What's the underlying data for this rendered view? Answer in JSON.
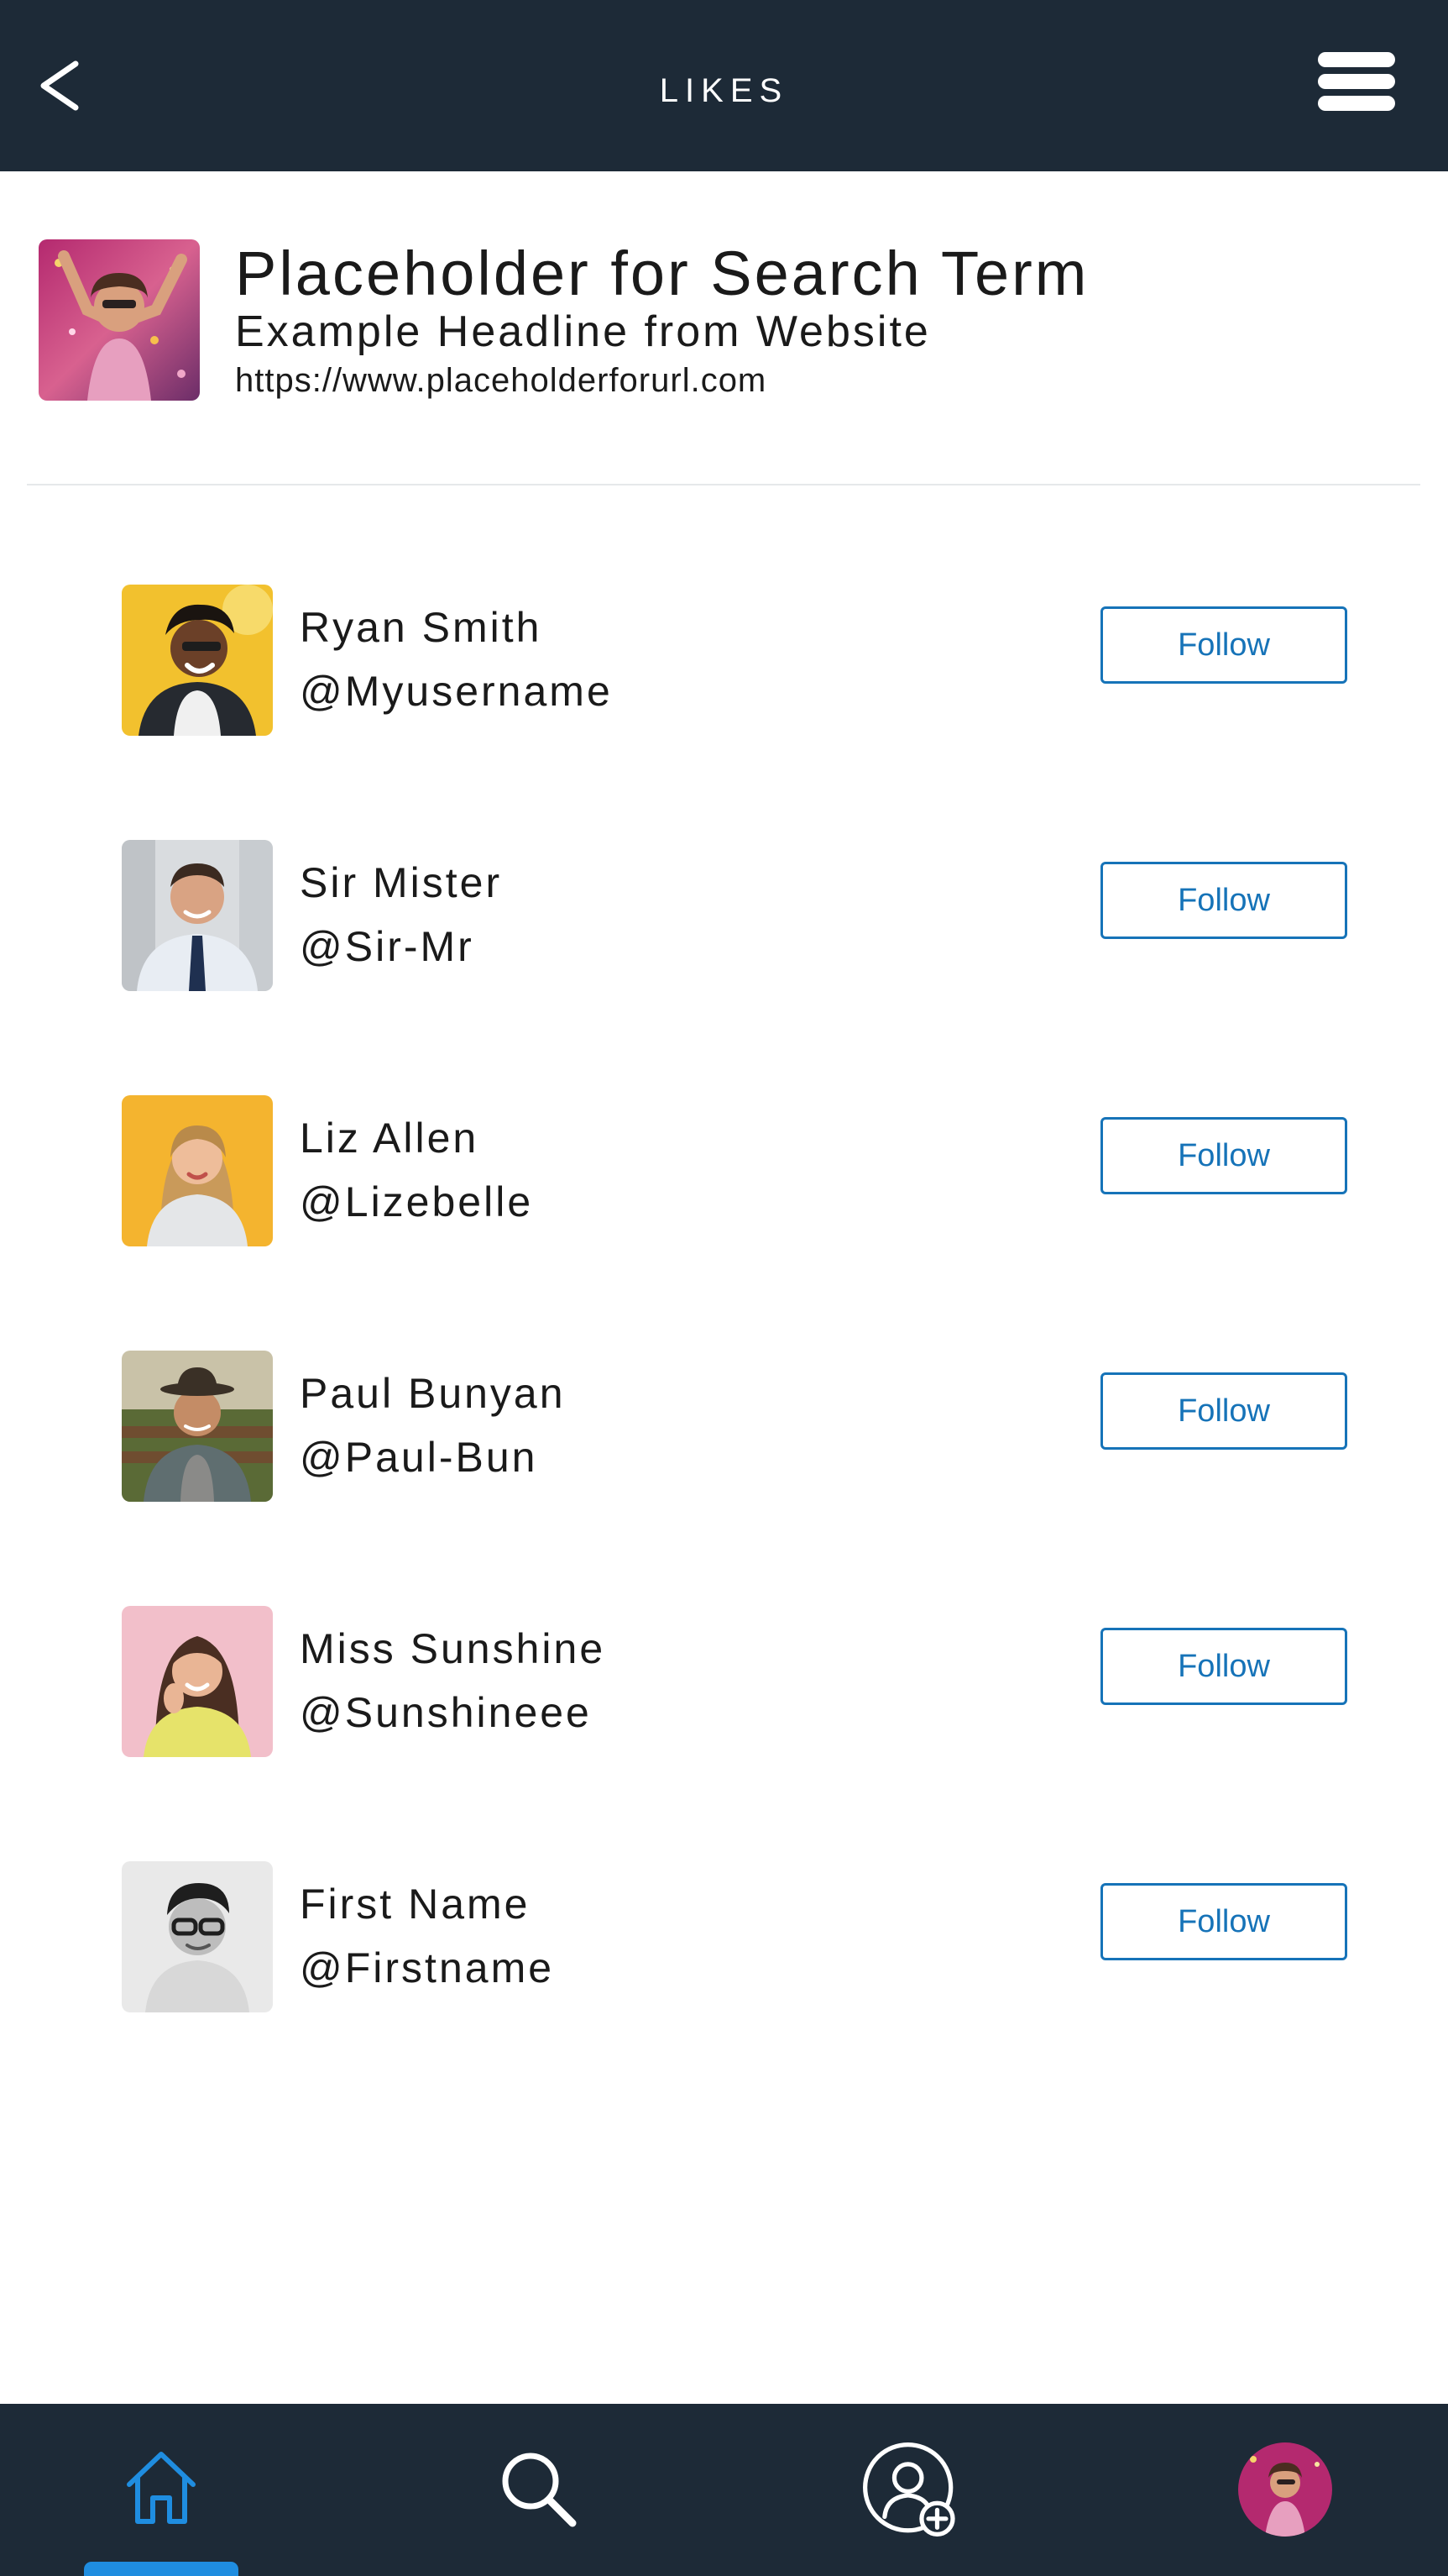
{
  "header": {
    "title": "LIKES",
    "back_icon": "chevron-left-icon",
    "menu_icon": "hamburger-menu-icon"
  },
  "shared_item": {
    "title": "Placeholder for Search Term",
    "headline": "Example Headline from Website",
    "url": "https://www.placeholderforurl.com"
  },
  "likes": [
    {
      "name": "Ryan Smith",
      "handle": "@Myusername",
      "follow_label": "Follow"
    },
    {
      "name": "Sir Mister",
      "handle": "@Sir-Mr",
      "follow_label": "Follow"
    },
    {
      "name": "Liz Allen",
      "handle": "@Lizebelle",
      "follow_label": "Follow"
    },
    {
      "name": "Paul Bunyan",
      "handle": "@Paul-Bun",
      "follow_label": "Follow"
    },
    {
      "name": "Miss Sunshine",
      "handle": "@Sunshineee",
      "follow_label": "Follow"
    },
    {
      "name": "First Name",
      "handle": "@Firstname",
      "follow_label": "Follow"
    }
  ],
  "bottom_nav": {
    "items": [
      {
        "id": "home",
        "icon": "home-icon",
        "active": true
      },
      {
        "id": "search",
        "icon": "search-icon",
        "active": false
      },
      {
        "id": "add-friend",
        "icon": "add-user-icon",
        "active": false
      },
      {
        "id": "profile",
        "icon": "profile-avatar",
        "active": false
      }
    ]
  },
  "colors": {
    "header_bg": "#1d2a37",
    "accent": "#1673b8",
    "active_nav": "#1f8de0",
    "divider": "#e6e8ea",
    "text": "#1a1a1a"
  }
}
